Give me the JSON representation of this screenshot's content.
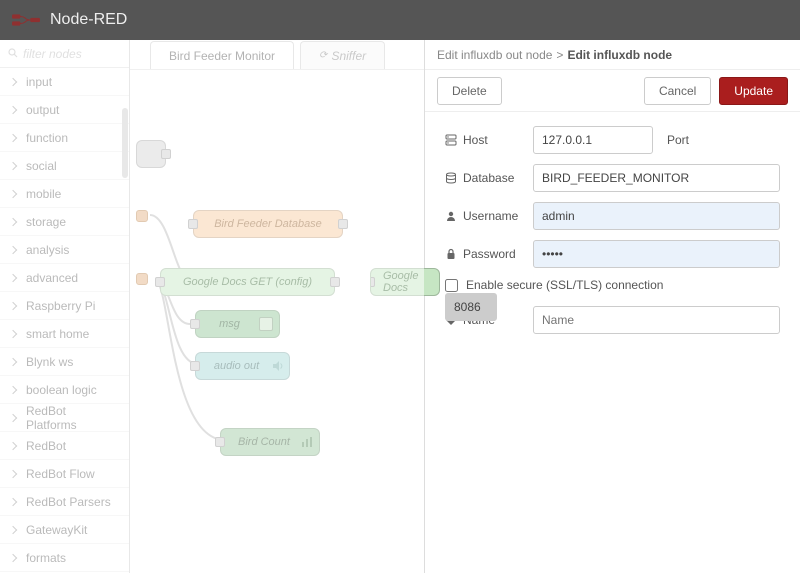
{
  "header": {
    "title": "Node-RED"
  },
  "palette": {
    "filter_placeholder": "filter nodes",
    "categories": [
      "input",
      "output",
      "function",
      "social",
      "mobile",
      "storage",
      "analysis",
      "advanced",
      "Raspberry Pi",
      "smart home",
      "Blynk ws",
      "boolean logic",
      "RedBot Platforms",
      "RedBot",
      "RedBot Flow",
      "RedBot Parsers",
      "GatewayKit",
      "formats"
    ]
  },
  "tabs": [
    {
      "label": "Bird Feeder Monitor",
      "active": true
    },
    {
      "label": "Sniffer",
      "active": false
    }
  ],
  "nodes": {
    "db": "Bird Feeder Database",
    "gd_get": "Google Docs GET (config)",
    "gd": "Google Docs",
    "msg": "msg",
    "audio": "audio out",
    "count": "Bird Count"
  },
  "sidebar": {
    "breadcrumb_parent": "Edit influxdb out node",
    "breadcrumb_sep": ">",
    "breadcrumb_current": "Edit influxdb node",
    "delete": "Delete",
    "cancel": "Cancel",
    "update": "Update",
    "labels": {
      "host": "Host",
      "port": "Port",
      "database": "Database",
      "username": "Username",
      "password": "Password",
      "ssl": "Enable secure (SSL/TLS) connection",
      "name": "Name"
    },
    "values": {
      "host": "127.0.0.1",
      "port": "8086",
      "database": "BIRD_FEEDER_MONITOR",
      "username": "admin",
      "password": "•••••",
      "name_placeholder": "Name"
    }
  }
}
